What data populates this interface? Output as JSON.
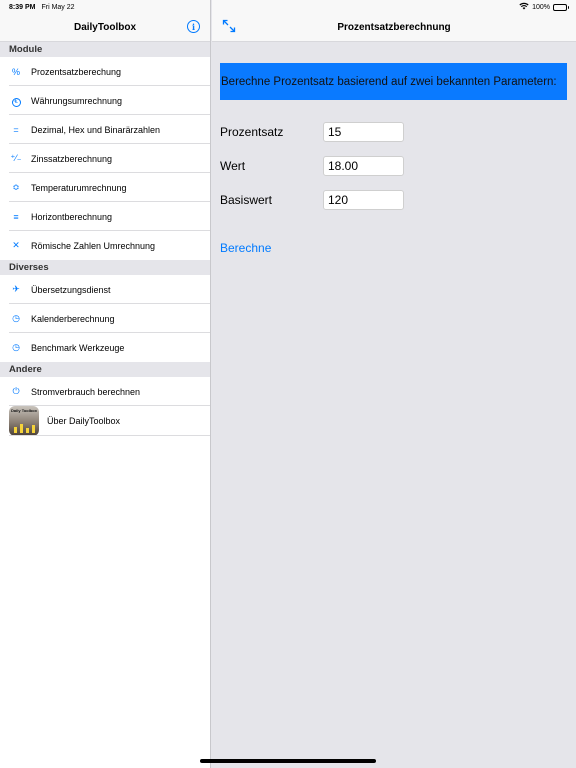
{
  "status_bar": {
    "time": "8:39 PM",
    "date": "Fri May 22",
    "battery": "100%",
    "battery_level": 1.0
  },
  "sidebar": {
    "title": "DailyToolbox",
    "info_glyph": "i",
    "sections": [
      {
        "header": "Module",
        "items": [
          {
            "label": "Prozentsatzberechung",
            "icon": "percent-icon",
            "glyph": "%"
          },
          {
            "label": "Währungsumrechnung",
            "icon": "currency-icon",
            "glyph": "€"
          },
          {
            "label": "Dezimal, Hex und Binarärzahlen",
            "icon": "equals-icon",
            "glyph": "="
          },
          {
            "label": "Zinssatzberechnung",
            "icon": "percent-slash-icon",
            "glyph": "⁺⁄₋"
          },
          {
            "label": "Temperaturumrechnung",
            "icon": "thermometer-icon",
            "glyph": "≎"
          },
          {
            "label": "Horizontberechnung",
            "icon": "lines-icon",
            "glyph": "≡"
          },
          {
            "label": "Römische Zahlen Umrechnung",
            "icon": "x-icon",
            "glyph": "✕"
          }
        ]
      },
      {
        "header": "Diverses",
        "items": [
          {
            "label": "Übersetzungsdienst",
            "icon": "airplane-icon",
            "glyph": "✈"
          },
          {
            "label": "Kalenderberechnung",
            "icon": "clock-icon",
            "glyph": "◷"
          },
          {
            "label": "Benchmark Werkzeuge",
            "icon": "clock-icon",
            "glyph": "◷"
          }
        ]
      },
      {
        "header": "Andere",
        "items": [
          {
            "label": "Stromverbrauch berechnen",
            "icon": "power-icon",
            "glyph": "⏻"
          },
          {
            "label": "Über DailyToolbox",
            "icon": "app-icon",
            "app_icon_text": "Daily Toolbox"
          }
        ]
      }
    ]
  },
  "main": {
    "title": "Prozentsatzberechnung",
    "banner": "Berechne Prozentsatz basierend auf zwei bekannten Parametern:",
    "fields": [
      {
        "label": "Prozentsatz",
        "value": "15"
      },
      {
        "label": "Wert",
        "value": "18.00"
      },
      {
        "label": "Basiswert",
        "value": "120"
      }
    ],
    "calc_button": "Berechne"
  },
  "colors": {
    "accent": "#007aff",
    "banner": "#0a7aff",
    "detail_bg": "#e5e5ea"
  }
}
